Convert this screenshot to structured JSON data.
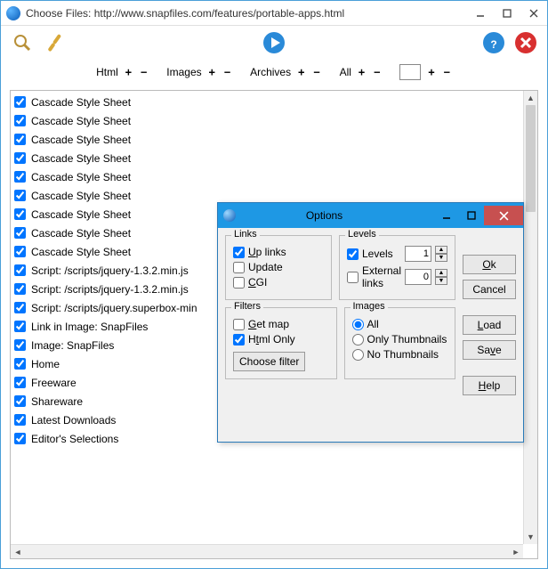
{
  "window": {
    "title": "Choose Files: http://www.snapfiles.com/features/portable-apps.html"
  },
  "filterbar": {
    "html": "Html",
    "images": "Images",
    "archives": "Archives",
    "all": "All",
    "plus": "+",
    "minus": "−"
  },
  "items": [
    "Cascade Style Sheet",
    "Cascade Style Sheet",
    "Cascade Style Sheet",
    "Cascade Style Sheet",
    "Cascade Style Sheet",
    "Cascade Style Sheet",
    "Cascade Style Sheet",
    "Cascade Style Sheet",
    "Cascade Style Sheet",
    "Script: /scripts/jquery-1.3.2.min.js",
    "Script: /scripts/jquery-1.3.2.min.js",
    "Script: /scripts/jquery.superbox-min",
    "Link in Image: SnapFiles",
    "Image: SnapFiles",
    "Home",
    "Freeware",
    "Shareware",
    "Latest Downloads",
    "Editor's Selections"
  ],
  "dialog": {
    "title": "Options",
    "links": {
      "legend": "Links",
      "uplinks": "Up links",
      "update": "Update",
      "cgi": "CGI"
    },
    "levels": {
      "legend": "Levels",
      "levels": "Levels",
      "levels_val": "1",
      "ext": "External links",
      "ext_val": "0"
    },
    "filters": {
      "legend": "Filters",
      "getmap": "Get map",
      "htmlonly": "Html Only",
      "choose": "Choose filter"
    },
    "images": {
      "legend": "Images",
      "all": "All",
      "only": "Only Thumbnails",
      "no": "No Thumbnails"
    },
    "buttons": {
      "ok": "Ok",
      "cancel": "Cancel",
      "load": "Load",
      "save": "Save",
      "help": "Help"
    }
  }
}
